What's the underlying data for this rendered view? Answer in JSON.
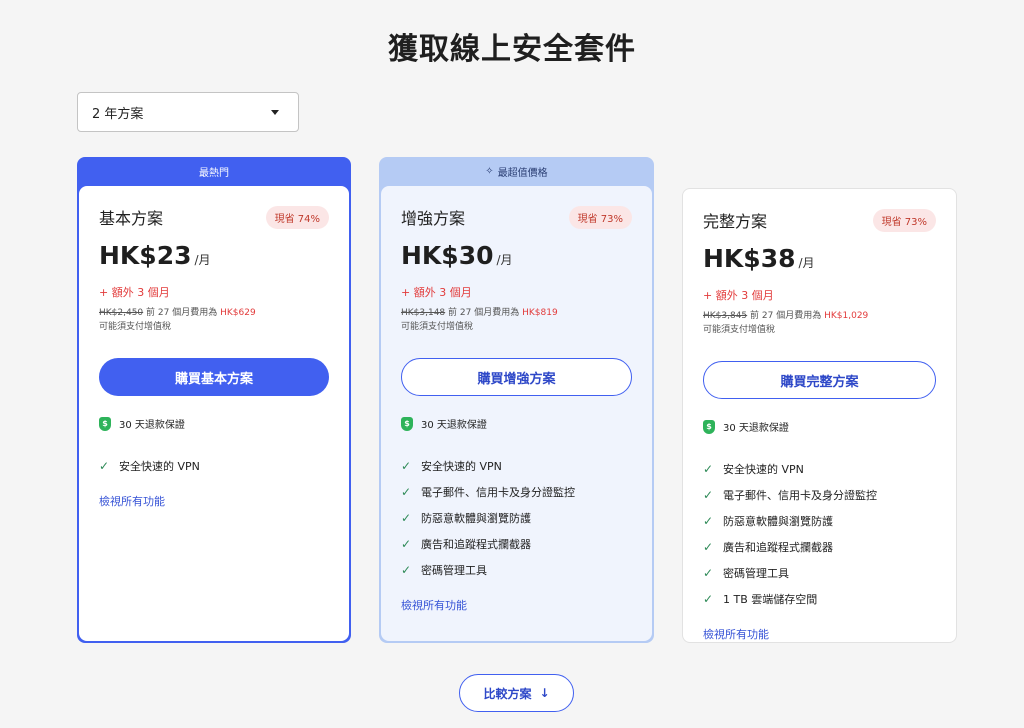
{
  "page_title": "獲取線上安全套件",
  "term_select": {
    "value": "2 年方案"
  },
  "plans": [
    {
      "ribbon": "最熱門",
      "name": "基本方案",
      "badge": "現省 74%",
      "price": "HK$23",
      "per": "/月",
      "bonus": "+ 額外 3 個月",
      "original_price": "HK$2,450",
      "renewal_text": "前 27 個月費用為",
      "renewal_price": "HK$629",
      "tax_note": "可能須支付增值稅",
      "cta": "購買基本方案",
      "guarantee": "30 天退款保證",
      "features": [
        "安全快速的 VPN"
      ],
      "view_all": "檢視所有功能"
    },
    {
      "ribbon": "最超值價格",
      "name": "增強方案",
      "badge": "現省 73%",
      "price": "HK$30",
      "per": "/月",
      "bonus": "+ 額外 3 個月",
      "original_price": "HK$3,148",
      "renewal_text": "前 27 個月費用為",
      "renewal_price": "HK$819",
      "tax_note": "可能須支付增值稅",
      "cta": "購買增強方案",
      "guarantee": "30 天退款保證",
      "features": [
        "安全快速的 VPN",
        "電子郵件、信用卡及身分證監控",
        "防惡意軟體與瀏覽防護",
        "廣告和追蹤程式攔截器",
        "密碼管理工具"
      ],
      "view_all": "檢視所有功能"
    },
    {
      "name": "完整方案",
      "badge": "現省 73%",
      "price": "HK$38",
      "per": "/月",
      "bonus": "+ 額外 3 個月",
      "original_price": "HK$3,845",
      "renewal_text": "前 27 個月費用為",
      "renewal_price": "HK$1,029",
      "tax_note": "可能須支付增值稅",
      "cta": "購買完整方案",
      "guarantee": "30 天退款保證",
      "features": [
        "安全快速的 VPN",
        "電子郵件、信用卡及身分證監控",
        "防惡意軟體與瀏覽防護",
        "廣告和追蹤程式攔截器",
        "密碼管理工具",
        "1 TB 雲端儲存空間"
      ],
      "view_all": "檢視所有功能"
    }
  ],
  "compare_button": "比較方案",
  "colors": {
    "accent": "#4160f0",
    "save_red": "#e23b3b",
    "check_green": "#2e8a57",
    "shield_green": "#2eb35a"
  }
}
